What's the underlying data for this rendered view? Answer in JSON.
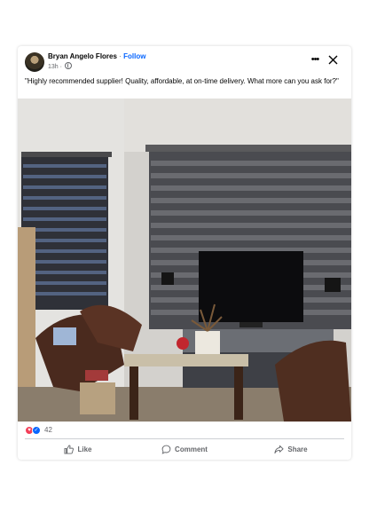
{
  "post": {
    "author": "Bryan Angelo Flores",
    "separator": "·",
    "follow_label": "Follow",
    "time": "13h ·",
    "caption": "\"Highly recommended supplier! Quality, affordable, at on-time delivery. What more can you ask for?\"",
    "photo_icon": "photo-living-room-blinds",
    "reaction_count": "42",
    "reaction_icons": [
      "love-icon",
      "like-icon"
    ],
    "more_icon": "more-options-icon",
    "close_icon": "close-icon"
  },
  "actions": {
    "like_label": "Like",
    "comment_label": "Comment",
    "share_label": "Share"
  },
  "colors": {
    "accent": "#0866ff",
    "love": "#f33e58",
    "secondary_text": "#65676b"
  }
}
